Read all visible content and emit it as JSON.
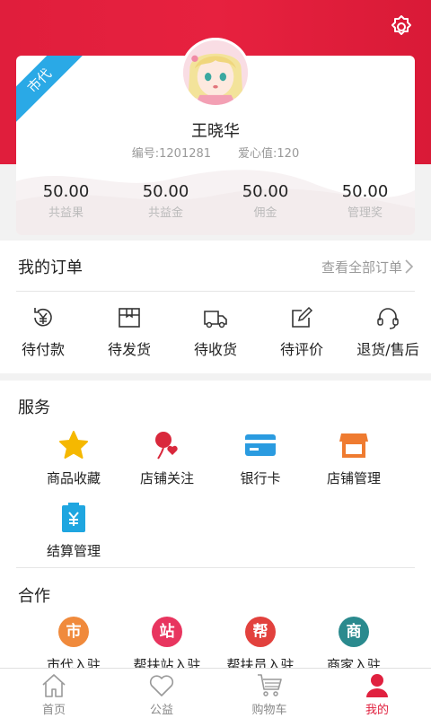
{
  "profile": {
    "ribbon": "市代",
    "name": "王晓华",
    "id_label": "编号:1201281",
    "love_label": "爱心值:120",
    "stats": [
      {
        "value": "50.00",
        "label": "共益果"
      },
      {
        "value": "50.00",
        "label": "共益金"
      },
      {
        "value": "50.00",
        "label": "佣金"
      },
      {
        "value": "50.00",
        "label": "管理奖"
      }
    ]
  },
  "orders": {
    "title": "我的订单",
    "view_all": "查看全部订单",
    "items": [
      {
        "label": "待付款",
        "icon": "yen-cycle-icon"
      },
      {
        "label": "待发货",
        "icon": "box-icon"
      },
      {
        "label": "待收货",
        "icon": "truck-icon"
      },
      {
        "label": "待评价",
        "icon": "edit-icon"
      },
      {
        "label": "退货/售后",
        "icon": "headset-icon"
      }
    ]
  },
  "services": {
    "title": "服务",
    "items": [
      {
        "label": "商品收藏",
        "icon": "star-icon"
      },
      {
        "label": "店铺关注",
        "icon": "balloon-heart-icon"
      },
      {
        "label": "银行卡",
        "icon": "card-icon"
      },
      {
        "label": "店铺管理",
        "icon": "shop-icon"
      },
      {
        "label": "结算管理",
        "icon": "yen-clipboard-icon"
      }
    ]
  },
  "cooperation": {
    "title": "合作",
    "items": [
      {
        "badge": "市",
        "label": "市代入驻",
        "color": "#f08a3c"
      },
      {
        "badge": "站",
        "label": "帮扶站入驻",
        "color": "#e8355f"
      },
      {
        "badge": "帮",
        "label": "帮扶员入驻",
        "color": "#e2413d"
      },
      {
        "badge": "商",
        "label": "商家入驻",
        "color": "#2a8a8e"
      }
    ]
  },
  "tabbar": [
    {
      "label": "首页",
      "icon": "home-icon"
    },
    {
      "label": "公益",
      "icon": "heart-icon"
    },
    {
      "label": "购物车",
      "icon": "cart-icon"
    },
    {
      "label": "我的",
      "icon": "person-icon",
      "active": true
    }
  ],
  "colors": {
    "brand": "#e01e3c",
    "ribbon": "#2aa9e6",
    "star": "#f5b800",
    "card": "#2a9be0",
    "shop": "#ef7b30",
    "clipboard": "#1fa6e0"
  }
}
